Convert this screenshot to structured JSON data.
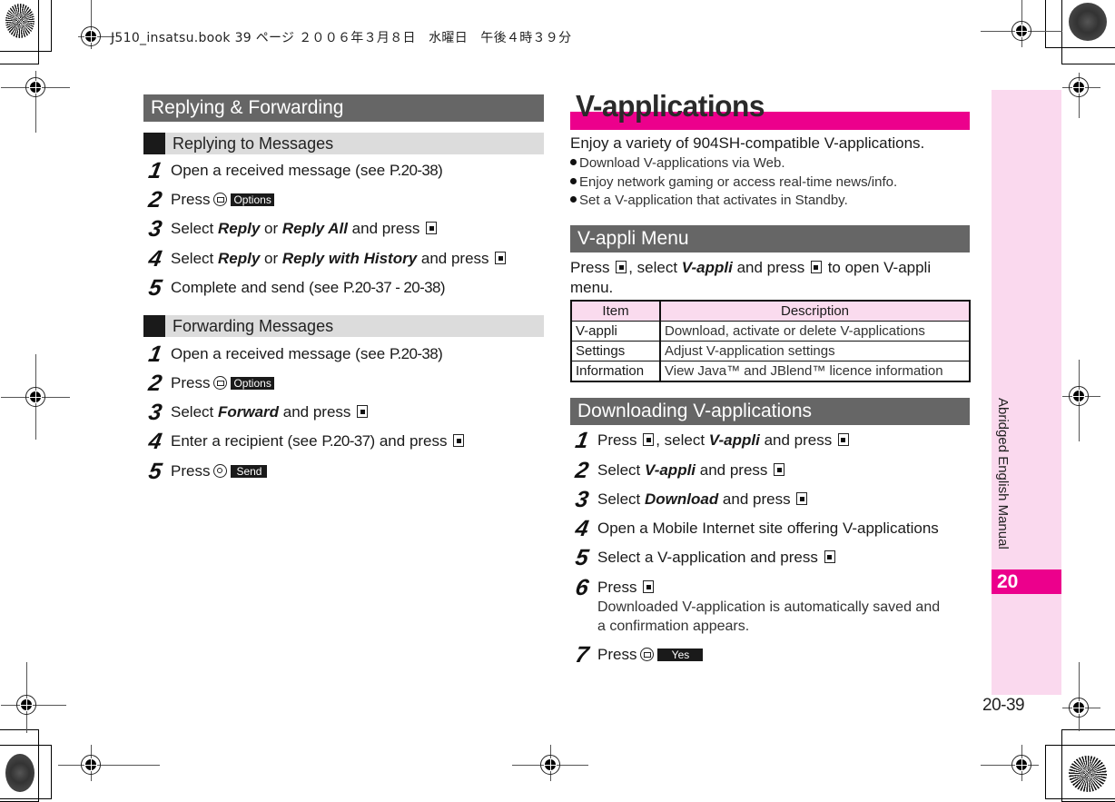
{
  "print_header": "J510_insatsu.book  39 ページ  ２００６年３月８日　水曜日　午後４時３９分",
  "left": {
    "section_title": "Replying & Forwarding",
    "replying": {
      "title": "Replying to Messages",
      "steps": [
        {
          "n": "1",
          "pre": "Open a received message (see ",
          "ref": "P.20-38",
          "post": ")"
        },
        {
          "n": "2",
          "pre": "Press",
          "key": "mail-key",
          "softkey": "Options"
        },
        {
          "n": "3",
          "pre": "Select ",
          "em1": "Reply",
          "mid": " or ",
          "em2": "Reply All",
          "post": " and press",
          "key": "center-key"
        },
        {
          "n": "4",
          "pre": "Select ",
          "em1": "Reply",
          "mid": " or ",
          "em2": "Reply with History",
          "post": " and press",
          "key": "center-key"
        },
        {
          "n": "5",
          "pre": "Complete and send (see ",
          "ref": "P.20-37 - 20-38",
          "post": ")"
        }
      ]
    },
    "forwarding": {
      "title": "Forwarding Messages",
      "steps": [
        {
          "n": "1",
          "pre": "Open a received message (see ",
          "ref": "P.20-38",
          "post": ")"
        },
        {
          "n": "2",
          "pre": "Press",
          "key": "mail-key",
          "softkey": "Options"
        },
        {
          "n": "3",
          "pre": "Select ",
          "em1": "Forward",
          "post": " and press",
          "key": "center-key"
        },
        {
          "n": "4",
          "pre": "Enter a recipient (see ",
          "ref": "P.20-37",
          "post": ") and press",
          "key": "center-key"
        },
        {
          "n": "5",
          "pre": "Press",
          "key": "dial-key",
          "softkey": "Send"
        }
      ]
    }
  },
  "right": {
    "title": "V-applications",
    "intro": "Enjoy a variety of 904SH-compatible V-applications.",
    "bullets": [
      "Download V-applications via Web.",
      "Enjoy network gaming or access real-time news/info.",
      "Set a V-application that activates in Standby."
    ],
    "menu_section": {
      "title": "V-appli Menu",
      "text_1": "Press",
      "text_2": ", select ",
      "text_em": "V-appli",
      "text_3": " and press",
      "text_4": " to open V-appli",
      "text_5": "menu.",
      "table": {
        "headers": [
          "Item",
          "Description"
        ],
        "rows": [
          [
            "V-appli",
            "Download, activate or delete V-applications"
          ],
          [
            "Settings",
            "Adjust V-application settings"
          ],
          [
            "Information",
            "View Java™ and JBlend™ licence information"
          ]
        ]
      }
    },
    "download_section": {
      "title": "Downloading V-applications",
      "steps": [
        {
          "n": "1",
          "pre": "Press",
          "post_a": ", select ",
          "em1": "V-appli",
          "post": " and press"
        },
        {
          "n": "2",
          "pre": "Select ",
          "em1": "V-appli",
          "post": " and press"
        },
        {
          "n": "3",
          "pre": "Select ",
          "em1": "Download",
          "post": " and press"
        },
        {
          "n": "4",
          "pre": "Open a Mobile Internet site offering V-applications"
        },
        {
          "n": "5",
          "pre": "Select a V-application and press"
        },
        {
          "n": "6",
          "pre": "Press",
          "note_1": "Downloaded V-application is automatically saved and",
          "note_2": "a confirmation appears."
        },
        {
          "n": "7",
          "pre": "Press",
          "softkey": "Yes"
        }
      ]
    }
  },
  "side_tab": {
    "label": "Abridged English Manual",
    "chapter": "20"
  },
  "page_number": "20-39",
  "colors": {
    "accent_magenta": "#ec008c",
    "side_tab_pink": "#fad9ee",
    "section_gray": "#666666",
    "subsection_gray": "#dcdcdc"
  }
}
